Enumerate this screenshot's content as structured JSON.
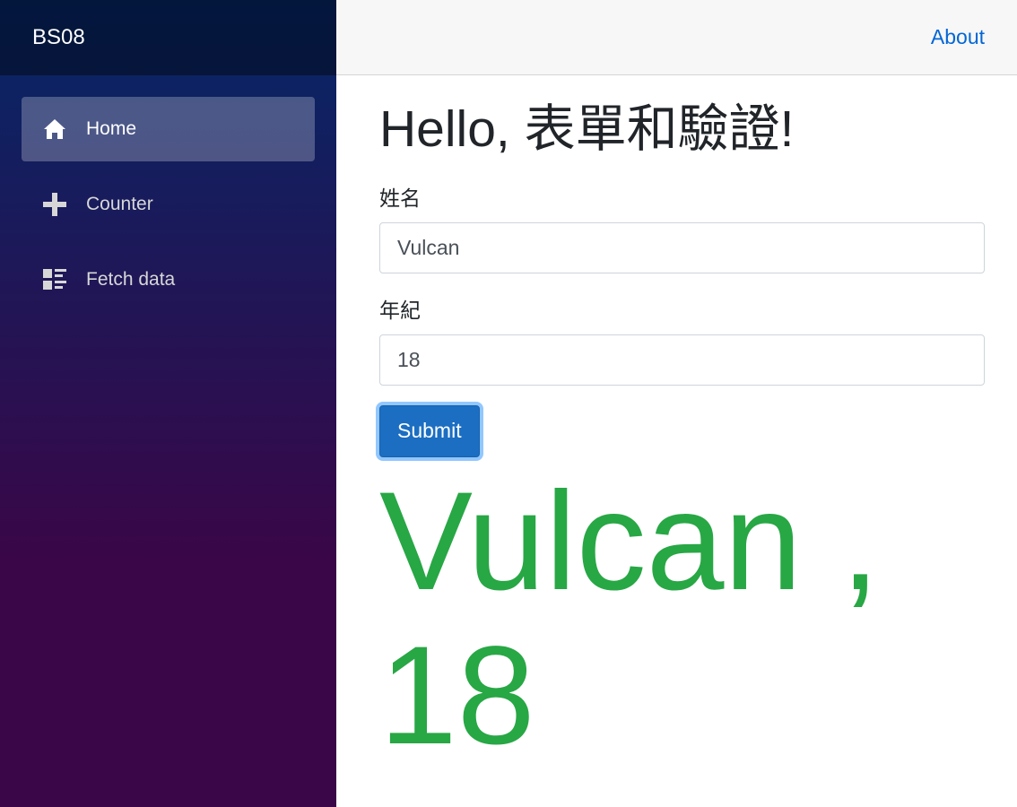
{
  "app": {
    "brand": "BS08"
  },
  "sidebar": {
    "items": [
      {
        "label": "Home",
        "icon": "home-icon",
        "active": true
      },
      {
        "label": "Counter",
        "icon": "plus-icon",
        "active": false
      },
      {
        "label": "Fetch data",
        "icon": "list-rich-icon",
        "active": false
      }
    ]
  },
  "top_row": {
    "about_label": "About"
  },
  "page": {
    "title": "Hello, 表單和驗證!"
  },
  "form": {
    "name_label": "姓名",
    "name_value": "Vulcan",
    "age_label": "年紀",
    "age_value": "18",
    "submit_label": "Submit"
  },
  "result": {
    "text": "Vulcan , 18"
  },
  "colors": {
    "accent": "#1b6ec2",
    "link": "#0366d6",
    "result": "#28a745",
    "sidebar_top": "#052767",
    "sidebar_bottom": "#3a0647"
  }
}
